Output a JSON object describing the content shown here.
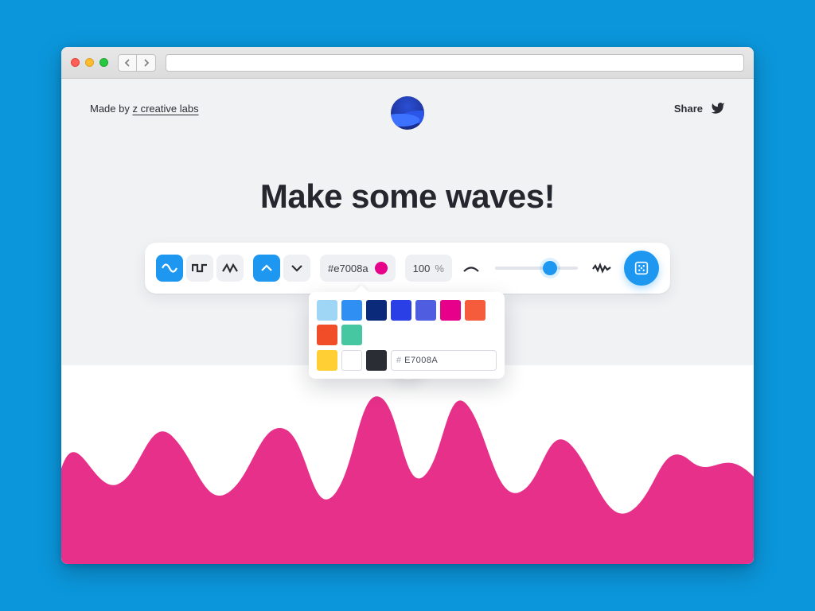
{
  "header": {
    "madeby_prefix": "Made by ",
    "madeby_link": "z creative labs",
    "share_label": "Share"
  },
  "title": "Make some waves!",
  "toolbar": {
    "color_hex_display": "#e7008a",
    "color_swatch": "#e7008a",
    "opacity_value": "100",
    "opacity_unit": "%",
    "slider_percent": 66
  },
  "picker": {
    "swatches_row1": [
      "#9fd6f6",
      "#2f8ff3",
      "#0b2a7a",
      "#2a3fe6",
      "#4f5de0",
      "#e7008a",
      "#f55c3b",
      "#f04d28",
      "#47c7a1"
    ],
    "swatches_row2": [
      "#ffcf33",
      "#ffffff",
      "#2a2d34"
    ],
    "hex_label": "#",
    "hex_value": "E7008A"
  },
  "wave": {
    "fill": "#e7308a"
  }
}
